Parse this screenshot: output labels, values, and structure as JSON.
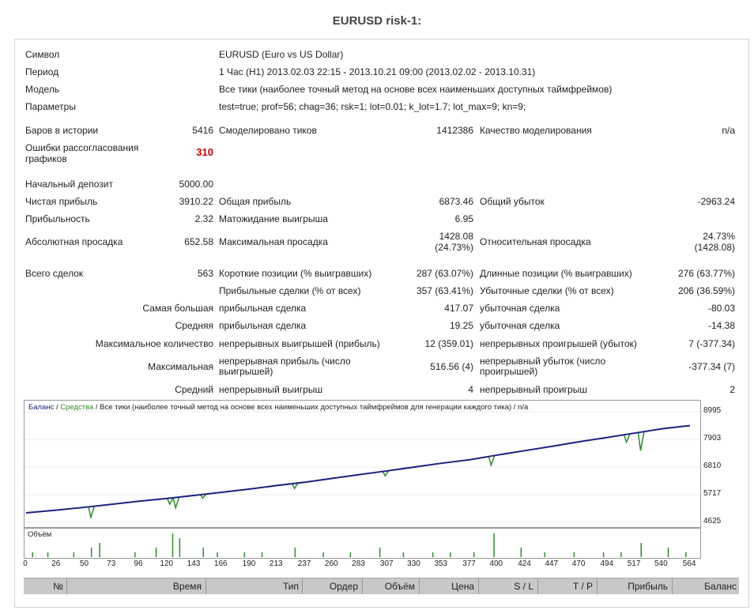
{
  "title": "EURUSD risk-1:",
  "info": {
    "symbol_label": "Символ",
    "symbol_value": "EURUSD (Euro vs US Dollar)",
    "period_label": "Период",
    "period_value": "1 Час (H1) 2013.02.03 22:15 - 2013.10.21 09:00 (2013.02.02 - 2013.10.31)",
    "model_label": "Модель",
    "model_value": "Все тики (наиболее точный метод на основе всех наименьших доступных таймфреймов)",
    "params_label": "Параметры",
    "params_value": "test=true; prof=56; chag=36; rsk=1; lot=0.01; k_lot=1.7; lot_max=9; kn=9;"
  },
  "stats": {
    "bars_label": "Баров в истории",
    "bars_value": "5416",
    "ticks_label": "Смоделировано тиков",
    "ticks_value": "1412386",
    "quality_label": "Качество моделирования",
    "quality_value": "n/a",
    "errors_label_1": "Ошибки рассогласования",
    "errors_label_2": "графиков",
    "errors_value": "310",
    "deposit_label": "Начальный депозит",
    "deposit_value": "5000.00",
    "net_label": "Чистая прибыль",
    "net_value": "3910.22",
    "gross_profit_label": "Общая прибыль",
    "gross_profit_value": "6873.46",
    "gross_loss_label": "Общий убыток",
    "gross_loss_value": "-2963.24",
    "pf_label": "Прибыльность",
    "pf_value": "2.32",
    "expect_label": "Матожидание выигрыша",
    "expect_value": "6.95",
    "abs_dd_label": "Абсолютная просадка",
    "abs_dd_value": "652.58",
    "max_dd_label": "Максимальная просадка",
    "max_dd_value_1": "1428.08",
    "max_dd_value_2": "(24.73%)",
    "rel_dd_label": "Относительная просадка",
    "rel_dd_value_1": "24.73%",
    "rel_dd_value_2": "(1428.08)",
    "total_label": "Всего сделок",
    "total_value": "563",
    "short_label": "Короткие позиции (% выигравших)",
    "short_value": "287 (63.07%)",
    "long_label": "Длинные позиции (% выигравших)",
    "long_value": "276 (63.77%)",
    "profit_trades_label": "Прибыльные сделки (% от всех)",
    "profit_trades_value": "357 (63.41%)",
    "loss_trades_label": "Убыточные сделки (% от всех)",
    "loss_trades_value": "206 (36.59%)",
    "largest_label": "Самая большая",
    "largest_profit_label": "прибыльная сделка",
    "largest_profit_value": "417.07",
    "largest_loss_label": "убыточная сделка",
    "largest_loss_value": "-80.03",
    "average_label": "Средняя",
    "average_profit_label": "прибыльная сделка",
    "average_profit_value": "19.25",
    "average_loss_label": "убыточная сделка",
    "average_loss_value": "-14.38",
    "max_count_label": "Максимальное количество",
    "max_count_wins_label": "непрерывных выигрышей (прибыль)",
    "max_count_wins_value": "12 (359.01)",
    "max_count_losses_label": "непрерывных проигрышей (убыток)",
    "max_count_losses_value": "7 (-377.34)",
    "maximal_label": "Максимальная",
    "maximal_profit_label_1": "непрерывная прибыль (число",
    "maximal_profit_label_2": "выигрышей)",
    "maximal_profit_value": "516.56 (4)",
    "maximal_loss_label_1": "непрерывный убыток (число",
    "maximal_loss_label_2": "проигрышей)",
    "maximal_loss_value": "-377.34 (7)",
    "avg_cons_label": "Средний",
    "avg_cons_wins_label": "непрерывный выигрыш",
    "avg_cons_wins_value": "4",
    "avg_cons_losses_label": "непрерывный проигрыш",
    "avg_cons_losses_value": "2"
  },
  "chart": {
    "legend_balance": "Баланс",
    "legend_sep1": " / ",
    "legend_equity": "Средства",
    "legend_rest": " / Все тики (наиболее точный метод на основе всех наименьших доступных таймфреймов для генерации каждого тика) / n/a",
    "volume_label": "Объём",
    "colors": {
      "balance": "#1a237e",
      "equity": "#2e8b2e",
      "volume": "#2e8b2e"
    }
  },
  "chart_data": {
    "type": "line",
    "y_ticks": [
      "8995",
      "7903",
      "6810",
      "5717",
      "4625"
    ],
    "x_ticks": [
      "0",
      "26",
      "50",
      "73",
      "96",
      "120",
      "143",
      "166",
      "190",
      "213",
      "237",
      "260",
      "283",
      "307",
      "330",
      "353",
      "377",
      "400",
      "424",
      "447",
      "470",
      "494",
      "517",
      "540",
      "564"
    ],
    "ylim": [
      4625,
      8995
    ],
    "xlim": [
      0,
      570
    ],
    "series": [
      {
        "name": "Баланс",
        "x": [
          0,
          26,
          50,
          73,
          96,
          120,
          143,
          166,
          190,
          213,
          237,
          260,
          283,
          307,
          330,
          353,
          377,
          400,
          424,
          447,
          470,
          494,
          517,
          540,
          564
        ],
        "values": [
          5000,
          5110,
          5220,
          5340,
          5460,
          5570,
          5690,
          5810,
          5940,
          6080,
          6210,
          6360,
          6510,
          6660,
          6810,
          6960,
          7100,
          7280,
          7460,
          7630,
          7810,
          7980,
          8150,
          8320,
          8450
        ]
      }
    ],
    "equity_dips": [
      {
        "x": 55,
        "value": 4820
      },
      {
        "x": 122,
        "value": 5340
      },
      {
        "x": 127,
        "value": 5200
      },
      {
        "x": 150,
        "value": 5580
      },
      {
        "x": 228,
        "value": 5960
      },
      {
        "x": 305,
        "value": 6460
      },
      {
        "x": 395,
        "value": 6880
      },
      {
        "x": 510,
        "value": 7790
      },
      {
        "x": 522,
        "value": 7460
      }
    ],
    "volume": {
      "x": [
        5,
        18,
        40,
        55,
        62,
        92,
        110,
        124,
        130,
        150,
        162,
        185,
        200,
        228,
        252,
        275,
        300,
        320,
        345,
        360,
        380,
        397,
        420,
        440,
        465,
        490,
        505,
        522,
        545,
        560
      ],
      "values": [
        1,
        1,
        1,
        2,
        3,
        1,
        2,
        5,
        4,
        2,
        1,
        1,
        1,
        2,
        1,
        1,
        2,
        1,
        1,
        1,
        1,
        5,
        2,
        1,
        1,
        1,
        1,
        3,
        2,
        1
      ]
    }
  },
  "table_header": [
    "№",
    "Время",
    "Тип",
    "Ордер",
    "Объём",
    "Цена",
    "S / L",
    "T / P",
    "Прибыль",
    "Баланс"
  ]
}
